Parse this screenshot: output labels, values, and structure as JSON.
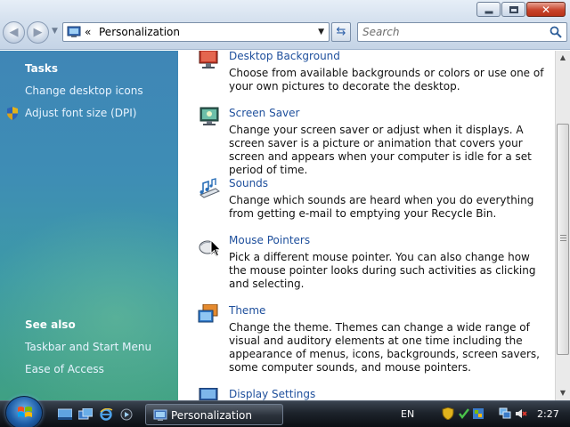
{
  "window": {
    "breadcrumb_prefix": "«",
    "breadcrumb": "Personalization",
    "search_placeholder": "Search",
    "controls": {
      "close_glyph": "✕"
    }
  },
  "nav": {
    "back_glyph": "◀",
    "forward_glyph": "▶",
    "dropdown_glyph": "▼",
    "refresh_glyph": "⇆"
  },
  "sidebar": {
    "tasks_heading": "Tasks",
    "tasks": [
      {
        "label": "Change desktop icons",
        "icon": "none"
      },
      {
        "label": "Adjust font size (DPI)",
        "icon": "uac-shield-icon"
      }
    ],
    "see_also_heading": "See also",
    "see_also": [
      {
        "label": "Taskbar and Start Menu"
      },
      {
        "label": "Ease of Access"
      }
    ]
  },
  "items": [
    {
      "title": "Desktop Background",
      "description": "Choose from available backgrounds or colors or use one of your own pictures to decorate the desktop.",
      "icon": "desktop-background-icon"
    },
    {
      "title": "Screen Saver",
      "description": "Change your screen saver or adjust when it displays. A screen saver is a picture or animation that covers your screen and appears when your computer is idle for a set period of time.",
      "icon": "screen-saver-icon"
    },
    {
      "title": "Sounds",
      "description": "Change which sounds are heard when you do everything from getting e-mail to emptying your Recycle Bin.",
      "icon": "sounds-icon"
    },
    {
      "title": "Mouse Pointers",
      "description": "Pick a different mouse pointer. You can also change how the mouse pointer looks during such activities as clicking and selecting.",
      "icon": "mouse-pointers-icon"
    },
    {
      "title": "Theme",
      "description": "Change the theme. Themes can change a wide range of visual and auditory elements at one time including the appearance of menus, icons, backgrounds, screen savers, some computer sounds, and mouse pointers.",
      "icon": "theme-icon"
    },
    {
      "title": "Display Settings",
      "description": "",
      "icon": "display-settings-icon"
    }
  ],
  "scrollbar": {
    "up_glyph": "▲",
    "down_glyph": "▼"
  },
  "taskbar": {
    "task_button_label": "Personalization",
    "language": "EN",
    "clock": "2:27"
  },
  "colors": {
    "link": "#1e4f9c",
    "sidebar_top": "#3f86b6",
    "sidebar_bottom": "#3fa083",
    "taskbar": "#1d232b"
  }
}
